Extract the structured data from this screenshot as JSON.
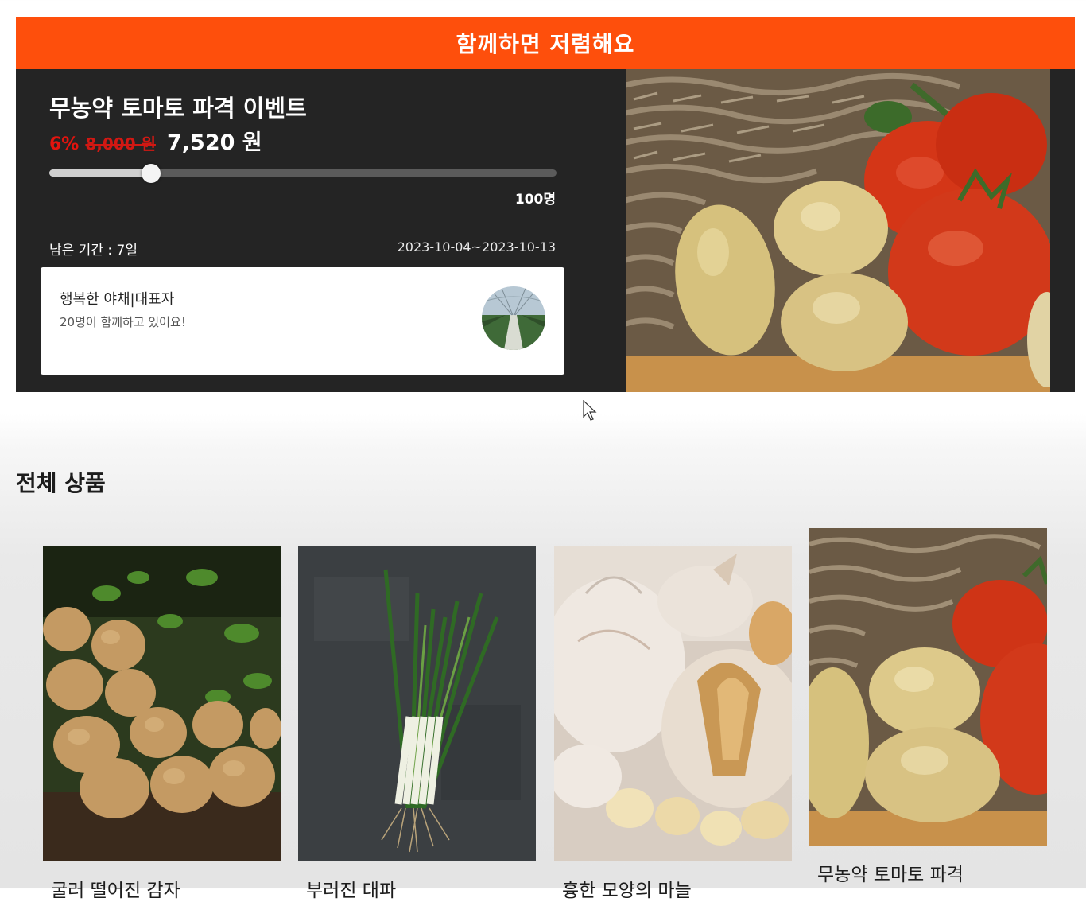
{
  "banner": {
    "header": "함께하면 저렴해요",
    "event_title": "무농약 토마토 파격 이벤트",
    "discount_rate": "6%",
    "original_price": "8,000 원",
    "sale_price": "7,520 원",
    "progress_fraction": 0.2,
    "goal_count": "100명",
    "remaining_period": "남은 기간 : 7일",
    "period_range": "2023-10-04~2023-10-13",
    "seller": {
      "name": "행복한 야채|대표자",
      "participants": "20명이 함께하고 있어요!"
    },
    "colors": {
      "accent": "#fe4f0c",
      "panel": "#242424",
      "discount": "#e3140e"
    }
  },
  "products_section": {
    "title": "전체 상품",
    "items": [
      {
        "name": "굴러 떨어진 감자",
        "icon": "potato-photo"
      },
      {
        "name": "부러진 대파",
        "icon": "green-onion-photo"
      },
      {
        "name": "흉한 모양의 마늘",
        "icon": "garlic-photo"
      },
      {
        "name": "무농약 토마토 파격",
        "icon": "tomato-potato-photo"
      }
    ]
  }
}
